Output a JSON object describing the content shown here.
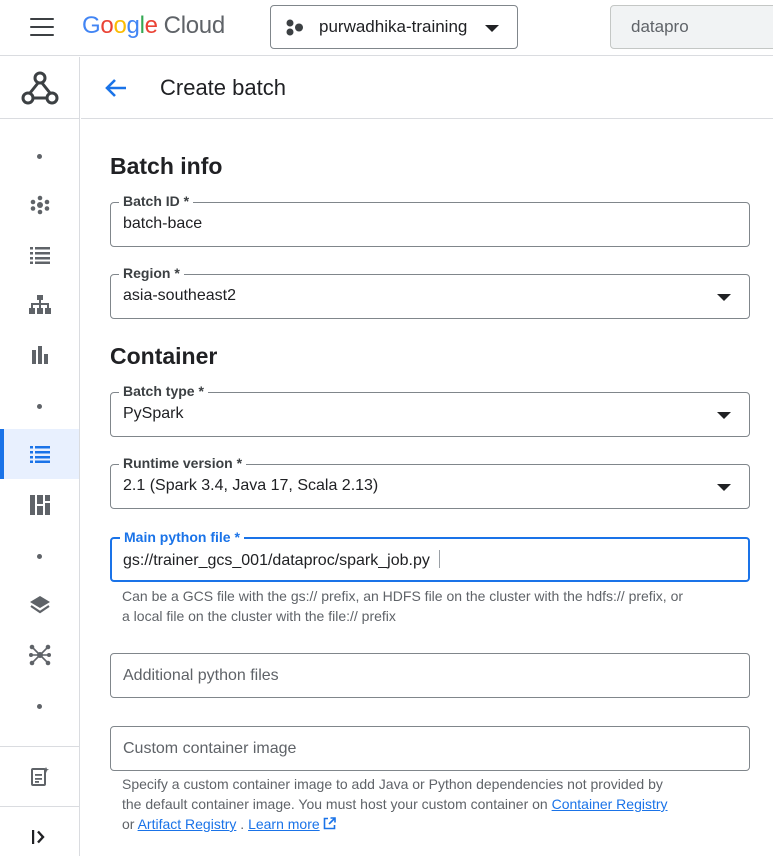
{
  "topbar": {
    "menu_icon": "hamburger-menu-icon",
    "logo": {
      "letters": [
        "G",
        "o",
        "o",
        "g",
        "l",
        "e"
      ],
      "product": "Cloud"
    },
    "project": {
      "name": "purwadhika-training",
      "icon": "project-hub-icon"
    },
    "search": {
      "value": "datapro"
    }
  },
  "rail": {
    "product_icon": "dataproc-logo-icon",
    "items": [
      {
        "icon": "dot-icon"
      },
      {
        "icon": "cluster-icon"
      },
      {
        "icon": "list-icon"
      },
      {
        "icon": "hierarchy-icon"
      },
      {
        "icon": "bar-chart-icon"
      },
      {
        "icon": "dot-icon"
      },
      {
        "icon": "batches-list-icon",
        "active": true
      },
      {
        "icon": "dashboard-icon"
      },
      {
        "icon": "dot-icon"
      },
      {
        "icon": "layers-icon"
      },
      {
        "icon": "network-icon"
      },
      {
        "icon": "dot-icon"
      }
    ],
    "bottom": [
      {
        "icon": "release-notes-icon"
      },
      {
        "icon": "expand-rail-icon"
      }
    ]
  },
  "header": {
    "back_icon": "back-arrow-icon",
    "title": "Create batch"
  },
  "batch_info": {
    "title": "Batch info",
    "batch_id": {
      "label": "Batch ID *",
      "value": "batch-bace"
    },
    "region": {
      "label": "Region *",
      "value": "asia-southeast2"
    }
  },
  "container": {
    "title": "Container",
    "batch_type": {
      "label": "Batch type *",
      "value": "PySpark"
    },
    "runtime_version": {
      "label": "Runtime version *",
      "value": "2.1 (Spark 3.4, Java 17, Scala 2.13)"
    },
    "main_python_file": {
      "label": "Main python file *",
      "value": "gs://trainer_gcs_001/dataproc/spark_job.py",
      "hint_line1": "Can be a GCS file with the gs:// prefix, an HDFS file on the cluster with the hdfs:// prefix, or",
      "hint_line2": "a local file on the cluster with the file:// prefix"
    },
    "additional_python_files": {
      "placeholder": "Additional python files"
    },
    "custom_container_image": {
      "placeholder": "Custom container image",
      "hint_line1": "Specify a custom container image to add Java or Python dependencies not provided by",
      "hint_line2_pre": "the default container image. You must host your custom container on ",
      "link_container_registry": "Container Registry",
      "hint_line3_pre": "or ",
      "link_artifact_registry": "Artifact Registry",
      "hint_line3_mid": " . ",
      "link_learn_more": "Learn more",
      "learn_more_icon": "open-in-new-icon"
    }
  },
  "colors": {
    "accent": "#1a73e8",
    "active_rail_bg": "#e8f0fe",
    "border": "#80868b"
  }
}
